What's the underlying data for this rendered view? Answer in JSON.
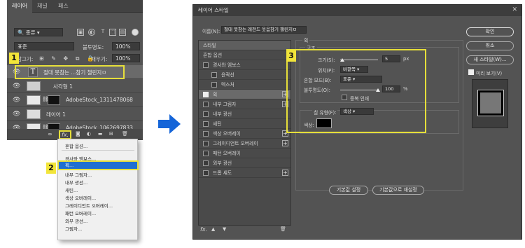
{
  "layers_panel": {
    "tabs": [
      "레이어",
      "채널",
      "패스"
    ],
    "filter_kind": "종류",
    "blend_mode": "표준",
    "opacity_label": "불투명도:",
    "opacity_value": "100%",
    "lock_label": "잠그기:",
    "fill_label": "채우기:",
    "fill_value": "100%",
    "layers": [
      {
        "name": "절대 못참는 ...참기 챌린지ㅁ",
        "type": "text"
      },
      {
        "name": "사각형 1",
        "type": "shape"
      },
      {
        "name": "AdobeStock_1311478068",
        "type": "image-mask"
      },
      {
        "name": "레이어 1",
        "type": "pixel"
      },
      {
        "name": "AdobeStock_1062697833",
        "type": "image-mask"
      }
    ],
    "fx_label": "fx."
  },
  "fx_menu": {
    "items": [
      "혼합 옵션...",
      "경사와 엠보스...",
      "획...",
      "내부 그림자...",
      "내부 광선...",
      "새틴...",
      "색상 오버레이...",
      "그레이디언트 오버레이...",
      "패턴 오버레이...",
      "외부 광선...",
      "그림자..."
    ],
    "selected_index": 2
  },
  "callouts": [
    "1",
    "2",
    "3"
  ],
  "layer_style_dialog": {
    "title": "레이어 스타일",
    "name_label": "이름(N):",
    "name_value": "절대 못참는 레전드 웃음참기 챌린지ㅁ",
    "styles_header": "스타일",
    "blend_options": "혼합 옵션",
    "style_items": [
      {
        "label": "경사와 엠보스",
        "checked": false,
        "plus": false
      },
      {
        "label": "윤곽선",
        "checked": false,
        "plus": false,
        "indent": true
      },
      {
        "label": "텍스처",
        "checked": false,
        "plus": false,
        "indent": true
      },
      {
        "label": "획",
        "checked": true,
        "plus": true
      },
      {
        "label": "내부 그림자",
        "checked": false,
        "plus": true
      },
      {
        "label": "내부 광선",
        "checked": false,
        "plus": false
      },
      {
        "label": "새틴",
        "checked": false,
        "plus": false
      },
      {
        "label": "색상 오버레이",
        "checked": false,
        "plus": true
      },
      {
        "label": "그레이디언트 오버레이",
        "checked": false,
        "plus": true
      },
      {
        "label": "패턴 오버레이",
        "checked": false,
        "plus": false
      },
      {
        "label": "외부 광선",
        "checked": false,
        "plus": false
      },
      {
        "label": "드롭 섀도",
        "checked": false,
        "plus": true
      }
    ],
    "stroke": {
      "section_title": "획",
      "structure_title": "구조",
      "size_label": "크기(S):",
      "size_value": "5",
      "size_unit": "px",
      "position_label": "위치(P):",
      "position_value": "바깥쪽",
      "blend_label": "혼합 모드(B):",
      "blend_value": "표준",
      "opacity_label": "불투명도(O):",
      "opacity_value": "100",
      "opacity_unit": "%",
      "overprint_label": "중복 인쇄",
      "fill_type_label": "칠 유형(F):",
      "fill_type_value": "색상",
      "color_label": "색상:",
      "color_value": "#000000"
    },
    "default_buttons": [
      "기본값 설정",
      "기본값으로 재설정"
    ],
    "right_buttons": [
      "확인",
      "취소",
      "새 스타일(W)..."
    ],
    "preview_label": "미리 보기(V)",
    "preview_checked": true,
    "bottom_icons": [
      "fx.",
      "▲",
      "▼"
    ]
  },
  "colors": {
    "accent": "#f2e53a",
    "selection": "#1f6fd1",
    "arrow": "#1565d8"
  }
}
